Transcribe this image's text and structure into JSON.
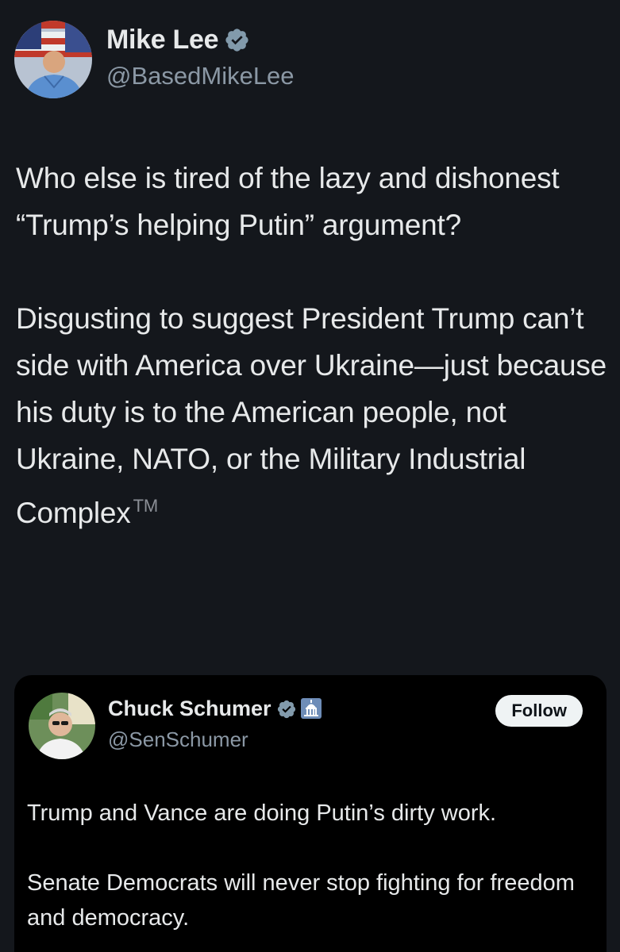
{
  "tweet": {
    "author": {
      "display_name": "Mike Lee",
      "handle": "@BasedMikeLee",
      "verified_icon": "verified-badge-icon",
      "avatar_icon": "avatar"
    },
    "paragraphs": [
      "Who else is tired of the lazy and dishonest “Trump’s helping Putin” argument?",
      "Disgusting to suggest President Trump can’t side with America over Ukraine—just because his duty is to the American people, not Ukraine, NATO, or the Military Industrial Complex"
    ],
    "trademark": "TM"
  },
  "quoted_tweet": {
    "author": {
      "display_name": "Chuck Schumer",
      "handle": "@SenSchumer",
      "verified_icon": "verified-badge-icon",
      "affiliation_icon": "government-capitol-icon"
    },
    "follow_label": "Follow",
    "paragraphs": [
      "Trump and Vance are doing Putin’s dirty work.",
      "Senate Democrats will never stop fighting for freedom and democracy."
    ]
  },
  "colors": {
    "background": "#14171c",
    "card_background": "#000000",
    "text_primary": "#e7e9ea",
    "text_secondary": "#8b98a5",
    "verified_badge": "#829aab",
    "follow_button_bg": "#eff3f4"
  }
}
